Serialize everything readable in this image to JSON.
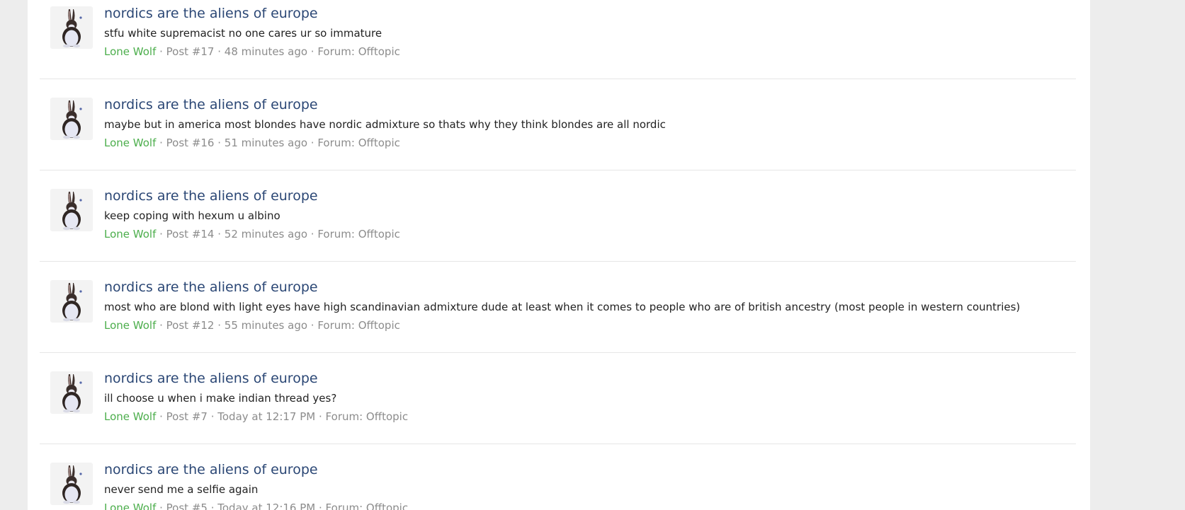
{
  "results": [
    {
      "title": "nordics are the aliens of europe",
      "snippet": "stfu white supremacist no one cares ur so immature",
      "author": "Lone Wolf",
      "post": "Post #17",
      "time": "48 minutes ago",
      "forum": "Forum: Offtopic",
      "avatar_icon": "rabbit-avatar-icon"
    },
    {
      "title": "nordics are the aliens of europe",
      "snippet": "maybe but in america most blondes have nordic admixture so thats why they think blondes are all nordic",
      "author": "Lone Wolf",
      "post": "Post #16",
      "time": "51 minutes ago",
      "forum": "Forum: Offtopic",
      "avatar_icon": "rabbit-avatar-icon"
    },
    {
      "title": "nordics are the aliens of europe",
      "snippet": "keep coping with hexum u albino",
      "author": "Lone Wolf",
      "post": "Post #14",
      "time": "52 minutes ago",
      "forum": "Forum: Offtopic",
      "avatar_icon": "rabbit-avatar-icon"
    },
    {
      "title": "nordics are the aliens of europe",
      "snippet": "most who are blond with light eyes have high scandinavian admixture dude at least when it comes to people who are of british ancestry (most people in western countries)",
      "author": "Lone Wolf",
      "post": "Post #12",
      "time": "55 minutes ago",
      "forum": "Forum: Offtopic",
      "avatar_icon": "rabbit-avatar-icon"
    },
    {
      "title": "nordics are the aliens of europe",
      "snippet": "ill choose u when i make indian thread yes?",
      "author": "Lone Wolf",
      "post": "Post #7",
      "time": "Today at 12:17 PM",
      "forum": "Forum: Offtopic",
      "avatar_icon": "rabbit-avatar-icon"
    },
    {
      "title": "nordics are the aliens of europe",
      "snippet": "never send me a selfie again",
      "author": "Lone Wolf",
      "post": "Post #5",
      "time": "Today at 12:16 PM",
      "forum": "Forum: Offtopic",
      "avatar_icon": "rabbit-avatar-icon"
    }
  ],
  "separator": " · ",
  "colors": {
    "title": "#2b4775",
    "author": "#4cae4c",
    "meta": "#8c8c8c",
    "page_background": "#ededed",
    "card_background": "#ffffff"
  }
}
